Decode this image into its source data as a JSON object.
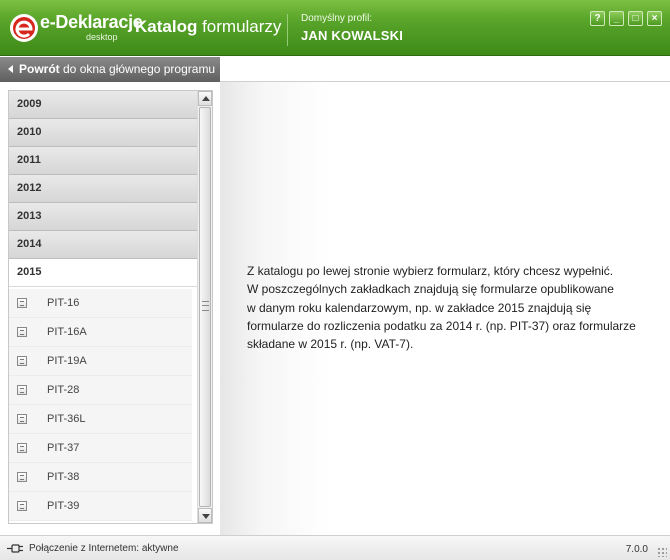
{
  "header": {
    "logo_text": "e-Deklaracje",
    "logo_sub": "desktop",
    "title_bold": "Katalog",
    "title_rest": " formularzy",
    "profile_label": "Domyślny profil:",
    "profile_name": "JAN KOWALSKI",
    "buttons": {
      "help": "?",
      "minimize": "_",
      "maximize": "□",
      "close": "×"
    },
    "colors": {
      "accent": "#5aa52a"
    }
  },
  "back": {
    "bold": "Powrót",
    "rest": " do okna głównego programu"
  },
  "years": [
    "2009",
    "2010",
    "2011",
    "2012",
    "2013",
    "2014"
  ],
  "open_year": "2015",
  "forms": [
    "PIT-16",
    "PIT-16A",
    "PIT-19A",
    "PIT-28",
    "PIT-36L",
    "PIT-37",
    "PIT-38",
    "PIT-39"
  ],
  "info": [
    "Z katalogu po lewej stronie wybierz formularz, który chcesz wypełnić.",
    "W poszczególnych zakładkach znajdują się formularze opublikowane",
    "w danym roku kalendarzowym, np. w zakładce 2015 znajdują się",
    "formularze do rozliczenia podatku za 2014 r. (np. PIT-37) oraz formularze",
    "składane w 2015 r. (np. VAT-7)."
  ],
  "status": {
    "connection": "Połączenie z Internetem: aktywne",
    "version": "7.0.0"
  }
}
